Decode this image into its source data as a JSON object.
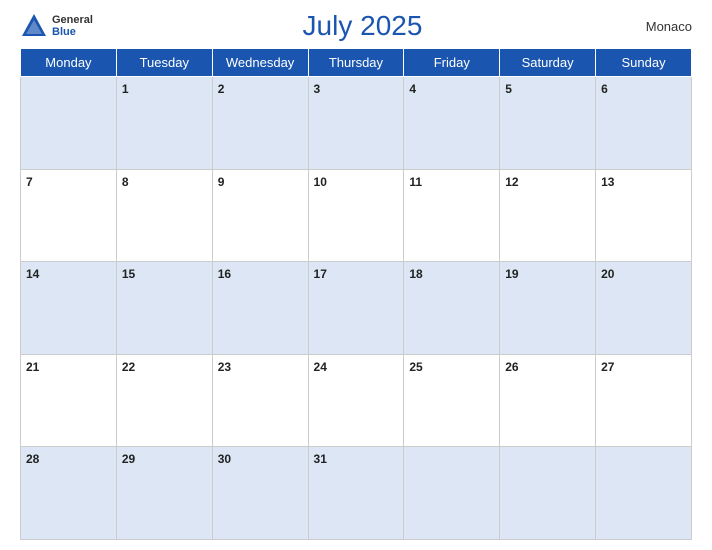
{
  "header": {
    "logo_general": "General",
    "logo_blue": "Blue",
    "title": "July 2025",
    "country": "Monaco"
  },
  "days_of_week": [
    "Monday",
    "Tuesday",
    "Wednesday",
    "Thursday",
    "Friday",
    "Saturday",
    "Sunday"
  ],
  "weeks": [
    [
      "",
      "1",
      "2",
      "3",
      "4",
      "5",
      "6"
    ],
    [
      "7",
      "8",
      "9",
      "10",
      "11",
      "12",
      "13"
    ],
    [
      "14",
      "15",
      "16",
      "17",
      "18",
      "19",
      "20"
    ],
    [
      "21",
      "22",
      "23",
      "24",
      "25",
      "26",
      "27"
    ],
    [
      "28",
      "29",
      "30",
      "31",
      "",
      "",
      ""
    ]
  ]
}
